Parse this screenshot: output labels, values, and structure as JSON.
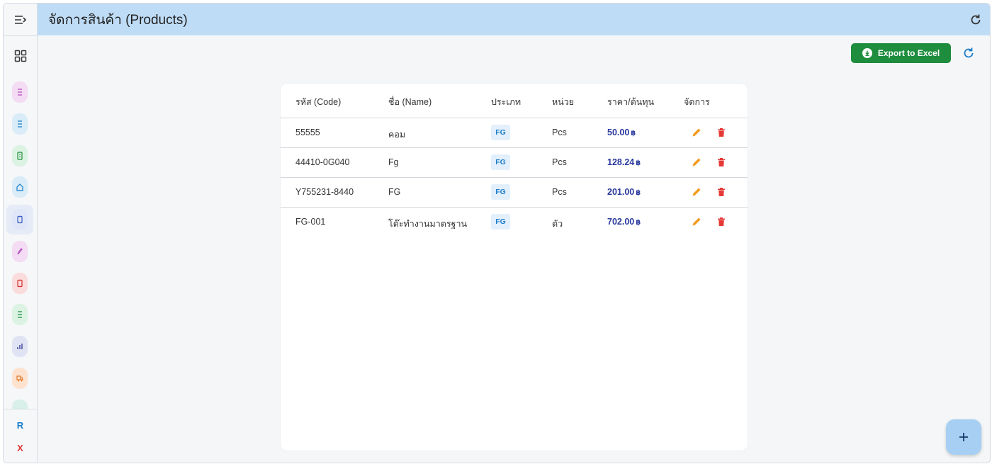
{
  "header": {
    "title": "จัดการสินค้า (Products)"
  },
  "toolbar": {
    "export_label": "Export to Excel"
  },
  "table": {
    "columns": [
      "รหัส (Code)",
      "ชื่อ (Name)",
      "ประเภท",
      "หน่วย",
      "ราคา/ต้นทุน",
      "จัดการ"
    ],
    "rows": [
      {
        "code": "55555",
        "name": "คอม",
        "type": "FG",
        "unit": "Pcs",
        "price": "50.00",
        "currency": "฿"
      },
      {
        "code": "44410-0G040",
        "name": "Fg",
        "type": "FG",
        "unit": "Pcs",
        "price": "128.24",
        "currency": "฿"
      },
      {
        "code": "Y755231-8440",
        "name": "FG",
        "type": "FG",
        "unit": "Pcs",
        "price": "201.00",
        "currency": "฿"
      },
      {
        "code": "FG-001",
        "name": "โต๊ะทำงานมาตรฐาน",
        "type": "FG",
        "unit": "ตัว",
        "price": "702.00",
        "currency": "฿"
      }
    ]
  },
  "sidebar": {
    "bottom": {
      "r_label": "R",
      "x_label": "X"
    },
    "item_colors": [
      "#f3dcf4",
      "#d9ecf8",
      "#dcf3e3",
      "#d9ecf8",
      "#dfe6f7",
      "#f3dcf4",
      "#fbdcdc",
      "#dcf3e3",
      "#dfe3f3",
      "#fde3cf",
      "#d9f0ea"
    ]
  },
  "colors": {
    "header_bg": "#bfdcf6",
    "export_green": "#1e8d3e",
    "edit_orange": "#f29b1d",
    "delete_red": "#e53935",
    "price_blue": "#2a3a9c"
  }
}
